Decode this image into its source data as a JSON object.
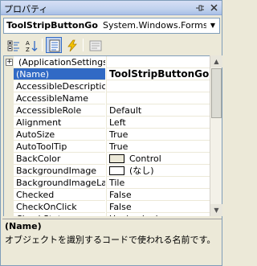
{
  "window": {
    "title": "プロパティ"
  },
  "object_selector": {
    "name": "ToolStripButtonGo",
    "type": "System.Windows.Forms.Too"
  },
  "toolbar": {
    "icons": [
      "categorized-icon",
      "alphabetical-icon",
      "properties-icon",
      "events-icon",
      "property-pages-icon"
    ],
    "active": "properties-icon"
  },
  "grid": {
    "rows": [
      {
        "name": "(ApplicationSettings)",
        "value": "",
        "kind": "category"
      },
      {
        "name": "(Name)",
        "value": "ToolStripButtonGo",
        "kind": "selected"
      },
      {
        "name": "AccessibleDescriptio",
        "value": ""
      },
      {
        "name": "AccessibleName",
        "value": ""
      },
      {
        "name": "AccessibleRole",
        "value": "Default"
      },
      {
        "name": "Alignment",
        "value": "Left"
      },
      {
        "name": "AutoSize",
        "value": "True"
      },
      {
        "name": "AutoToolTip",
        "value": "True"
      },
      {
        "name": "BackColor",
        "value": "Control",
        "swatch": "#ece9d8"
      },
      {
        "name": "BackgroundImage",
        "value": "(なし)",
        "swatch": "#ffffff"
      },
      {
        "name": "BackgroundImageLayo",
        "value": "Tile"
      },
      {
        "name": "Checked",
        "value": "False"
      },
      {
        "name": "CheckOnClick",
        "value": "False"
      },
      {
        "name": "CheckState",
        "value": "Unchecked"
      }
    ]
  },
  "help": {
    "title": "(Name)",
    "description": "オブジェクトを識別するコードで使われる名前です。"
  },
  "colors": {
    "selection": "#316ac5",
    "frame": "#ece9d8",
    "border": "#7f9db9"
  }
}
